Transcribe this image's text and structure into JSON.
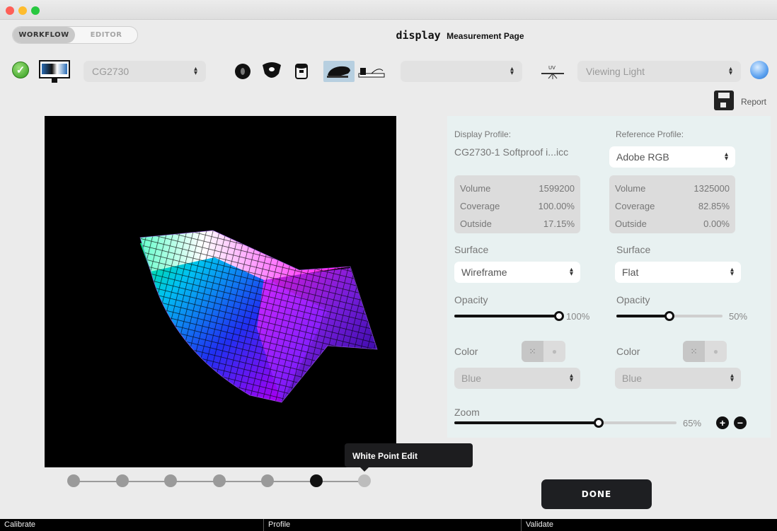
{
  "header": {
    "tabs": [
      {
        "label": "WORKFLOW",
        "active": true
      },
      {
        "label": "EDITOR",
        "active": false
      }
    ],
    "title_main": "display",
    "title_sub": "Measurement Page"
  },
  "toolbar": {
    "display_select": "CG2730",
    "device_select": "",
    "viewing_light_select": "Viewing Light",
    "uv_label": "UV",
    "report_label": "Report"
  },
  "panel": {
    "display_profile_label": "Display Profile:",
    "display_profile_value": "CG2730-1 Softproof i...icc",
    "reference_profile_label": "Reference Profile:",
    "reference_profile_value": "Adobe RGB",
    "display_stats": [
      {
        "label": "Volume",
        "value": "1599200"
      },
      {
        "label": "Coverage",
        "value": "100.00%"
      },
      {
        "label": "Outside",
        "value": "17.15%"
      }
    ],
    "reference_stats": [
      {
        "label": "Volume",
        "value": "1325000"
      },
      {
        "label": "Coverage",
        "value": "82.85%"
      },
      {
        "label": "Outside",
        "value": "0.00%"
      }
    ],
    "left": {
      "surface_label": "Surface",
      "surface_value": "Wireframe",
      "opacity_label": "Opacity",
      "opacity_value": "100%",
      "opacity_fraction": 1.0,
      "color_label": "Color",
      "color_value": "Blue"
    },
    "right": {
      "surface_label": "Surface",
      "surface_value": "Flat",
      "opacity_label": "Opacity",
      "opacity_value": "50%",
      "opacity_fraction": 0.5,
      "color_label": "Color",
      "color_value": "Blue"
    },
    "zoom_label": "Zoom",
    "zoom_value": "65%",
    "zoom_fraction": 0.65
  },
  "tooltip": "White Point Edit",
  "steps": {
    "count": 7,
    "current": 6
  },
  "done_label": "DONE",
  "bottom_bar": [
    "Calibrate",
    "Profile",
    "Validate"
  ],
  "colors": {
    "accent": "#1e1f22",
    "panel_bg": "#e8f1f1",
    "ok_green": "#2f9a1c"
  }
}
